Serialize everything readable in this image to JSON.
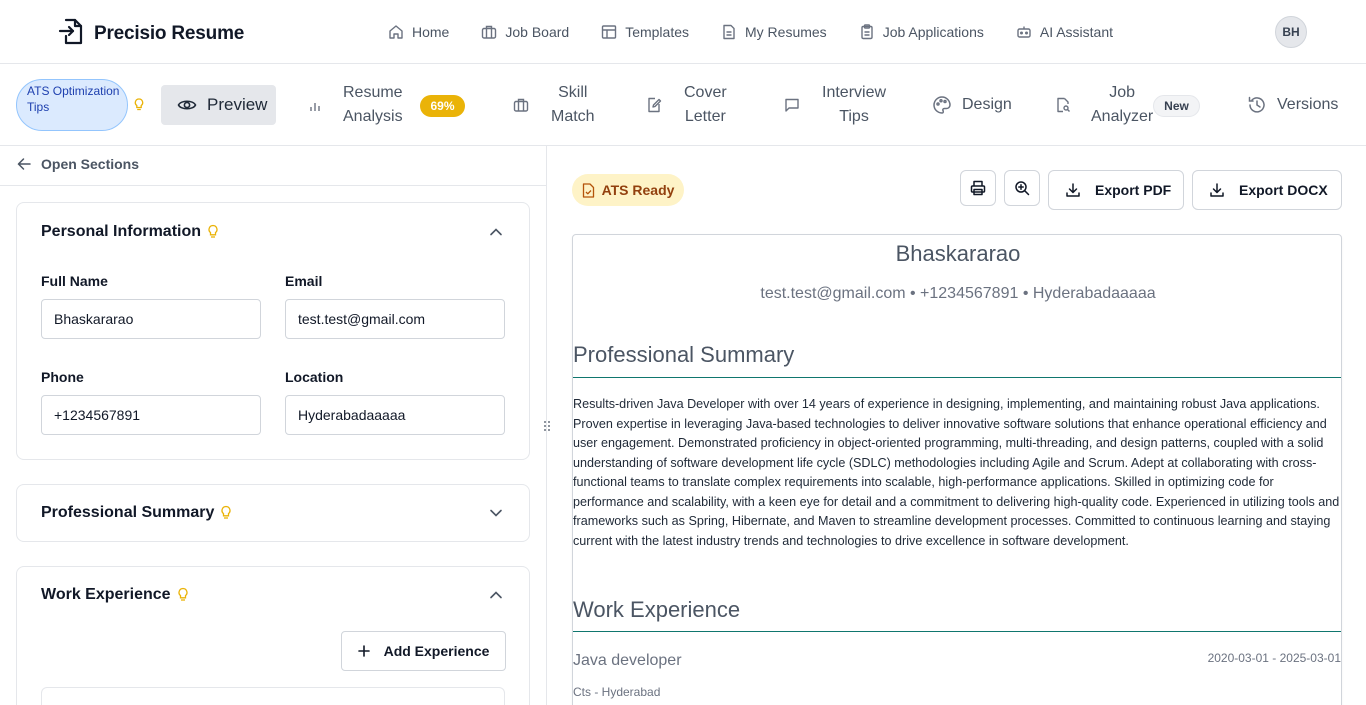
{
  "app": {
    "title": "Precisio Resume",
    "user_initials": "BH"
  },
  "nav": {
    "items": [
      {
        "label": "Home",
        "icon": "home-icon"
      },
      {
        "label": "Job Board",
        "icon": "briefcase-icon"
      },
      {
        "label": "Templates",
        "icon": "layout-icon"
      },
      {
        "label": "My Resumes",
        "icon": "file-text-icon"
      },
      {
        "label": "Job Applications",
        "icon": "clipboard-icon"
      },
      {
        "label": "AI Assistant",
        "icon": "bot-icon"
      }
    ]
  },
  "toolbar": {
    "ats_tips_label": "ATS Optimization Tips",
    "preview_label": "Preview",
    "resume_analysis_line1": "Resume",
    "resume_analysis_line2": "Analysis",
    "resume_analysis_score": "69%",
    "skill_match_line1": "Skill",
    "skill_match_line2": "Match",
    "cover_letter_line1": "Cover",
    "cover_letter_line2": "Letter",
    "interview_tips_line1": "Interview",
    "interview_tips_line2": "Tips",
    "design_label": "Design",
    "job_analyzer_line1": "Job",
    "job_analyzer_line2": "Analyzer",
    "job_analyzer_badge": "New",
    "versions_label": "Versions"
  },
  "editor": {
    "open_sections_label": "Open Sections",
    "personal_info": {
      "title": "Personal Information",
      "full_name_label": "Full Name",
      "full_name_value": "Bhaskararao",
      "email_label": "Email",
      "email_value": "test.test@gmail.com",
      "phone_label": "Phone",
      "phone_value": "+1234567891",
      "location_label": "Location",
      "location_value": "Hyderabadaaaaa"
    },
    "professional_summary": {
      "title": "Professional Summary"
    },
    "work_experience": {
      "title": "Work Experience",
      "add_button_label": "Add Experience"
    }
  },
  "preview": {
    "ats_ready_label": "ATS Ready",
    "export_pdf_label": "Export PDF",
    "export_docx_label": "Export DOCX",
    "resume": {
      "name": "Bhaskararao",
      "contact": "test.test@gmail.com • +1234567891 • Hyderabadaaaaa",
      "summary_heading": "Professional Summary",
      "summary_text": "Results-driven Java Developer with over 14 years of experience in designing, implementing, and maintaining robust Java applications. Proven expertise in leveraging Java-based technologies to deliver innovative software solutions that enhance operational efficiency and user engagement. Demonstrated proficiency in object-oriented programming, multi-threading, and design patterns, coupled with a solid understanding of software development life cycle (SDLC) methodologies including Agile and Scrum. Adept at collaborating with cross-functional teams to translate complex requirements into scalable, high-performance applications. Skilled in optimizing code for performance and scalability, with a keen eye for detail and a commitment to delivering high-quality code. Experienced in utilizing tools and frameworks such as Spring, Hibernate, and Maven to streamline development processes. Committed to continuous learning and staying current with the latest industry trends and technologies to drive excellence in software development.",
      "work_heading": "Work Experience",
      "job_title": "Java developer",
      "job_dates": "2020-03-01 - 2025-03-01",
      "job_company": "Cts - Hyderabad"
    }
  },
  "colors": {
    "accent_blue_bg": "#dbeafe",
    "accent_blue_text": "#1e40af",
    "score_yellow": "#eab308",
    "ats_ready_bg": "#fef3c7",
    "bulb": "#eab308",
    "resume_rule": "#0f766e"
  }
}
